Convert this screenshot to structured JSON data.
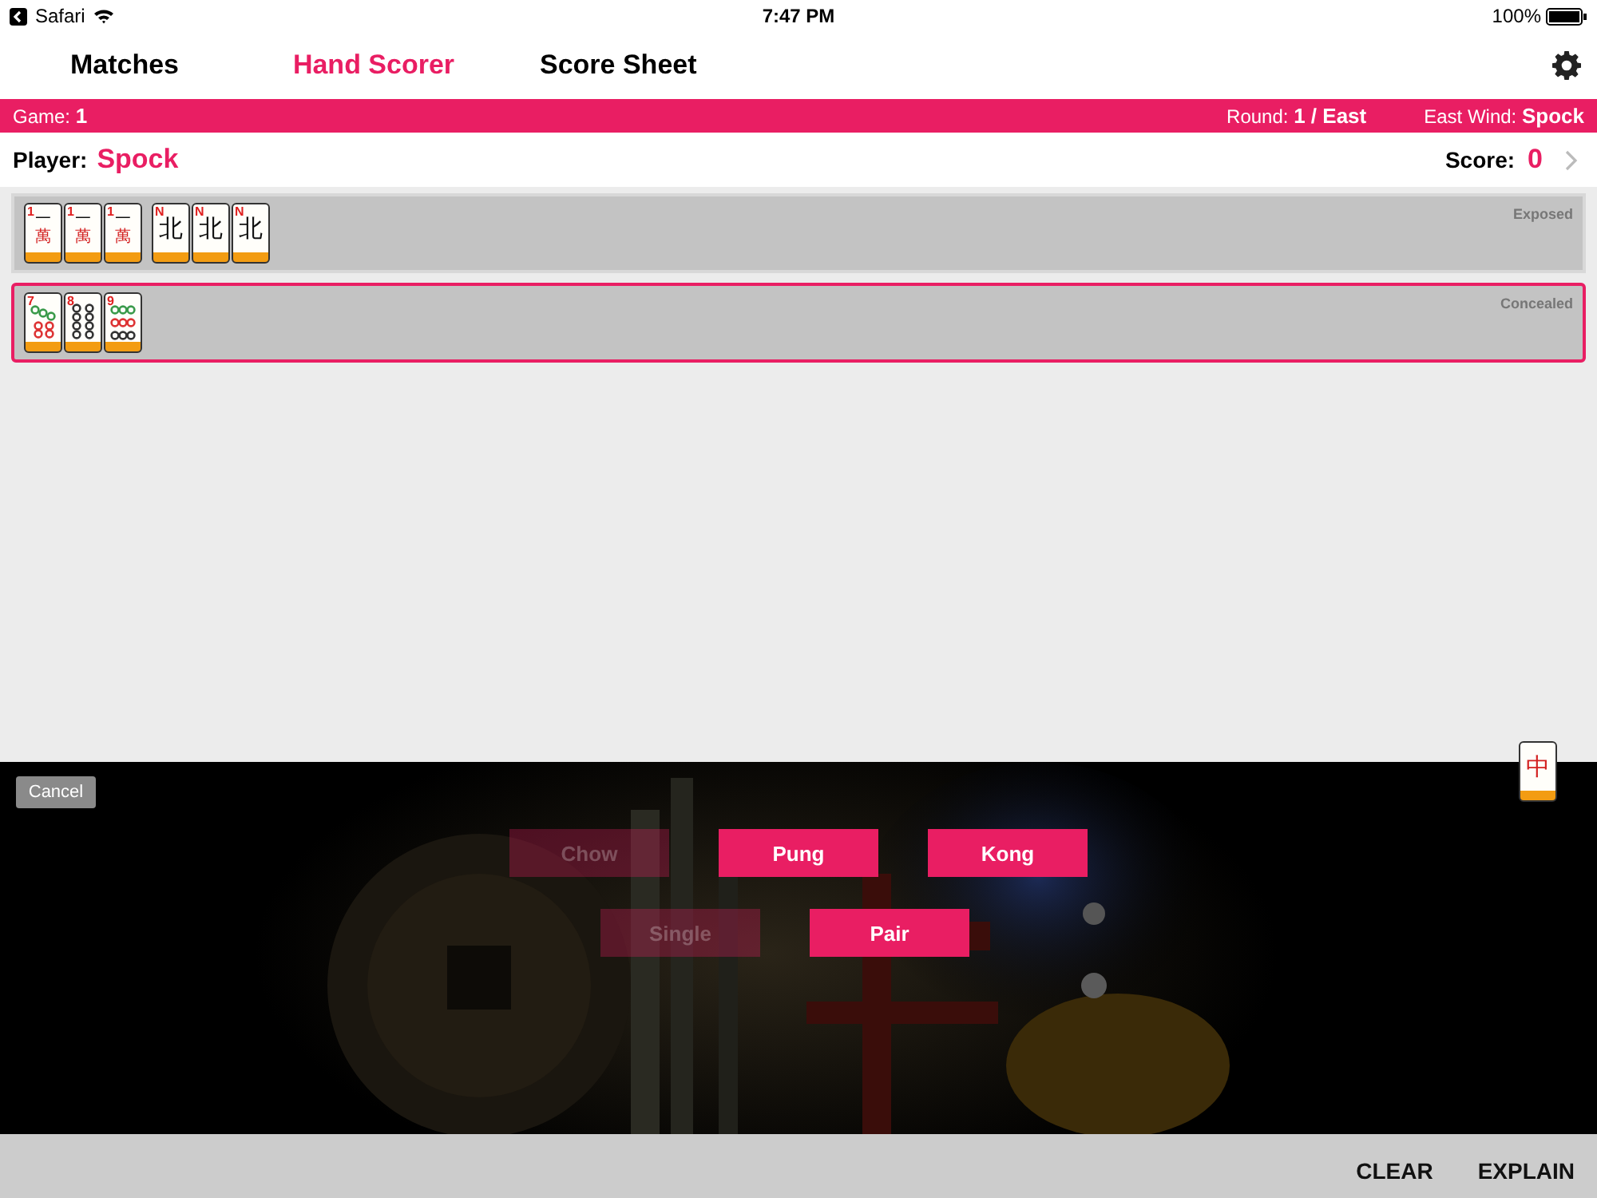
{
  "status_bar": {
    "back_app": "Safari",
    "time": "7:47 PM",
    "battery": "100%"
  },
  "tabs": [
    {
      "label": "Matches",
      "selected": false
    },
    {
      "label": "Hand Scorer",
      "selected": true
    },
    {
      "label": "Score Sheet",
      "selected": false
    }
  ],
  "info_bar": {
    "game_label": "Game:",
    "game": "1",
    "round_label": "Round:",
    "round": "1 / East",
    "east_wind_label": "East Wind:",
    "east_wind": "Spock"
  },
  "player_row": {
    "player_label": "Player:",
    "player": "Spock",
    "score_label": "Score:",
    "score": "0"
  },
  "groups": [
    {
      "label": "Exposed",
      "selected": false,
      "sets": [
        [
          {
            "kind": "character",
            "rank": "1",
            "glyphs": [
              "一",
              "萬"
            ]
          },
          {
            "kind": "character",
            "rank": "1",
            "glyphs": [
              "一",
              "萬"
            ]
          },
          {
            "kind": "character",
            "rank": "1",
            "glyphs": [
              "一",
              "萬"
            ]
          }
        ],
        [
          {
            "kind": "wind",
            "rank": "N",
            "glyphs": [
              "北"
            ]
          },
          {
            "kind": "wind",
            "rank": "N",
            "glyphs": [
              "北"
            ]
          },
          {
            "kind": "wind",
            "rank": "N",
            "glyphs": [
              "北"
            ]
          }
        ]
      ]
    },
    {
      "label": "Concealed",
      "selected": true,
      "sets": [
        [
          {
            "kind": "diagonal",
            "rank": "7"
          },
          {
            "kind": "columns",
            "rank": "8"
          },
          {
            "kind": "rows",
            "rank": "9"
          }
        ]
      ]
    }
  ],
  "current_tile": {
    "kind": "dragon",
    "glyphs": [
      "中"
    ]
  },
  "cancel": "Cancel",
  "actions": [
    [
      {
        "label": "Chow",
        "disabled": true
      },
      {
        "label": "Pung",
        "disabled": false
      },
      {
        "label": "Kong",
        "disabled": false
      }
    ],
    [
      {
        "label": "Single",
        "disabled": true
      },
      {
        "label": "Pair",
        "disabled": false
      }
    ]
  ],
  "bottom_buttons": [
    "CLEAR",
    "EXPLAIN"
  ]
}
